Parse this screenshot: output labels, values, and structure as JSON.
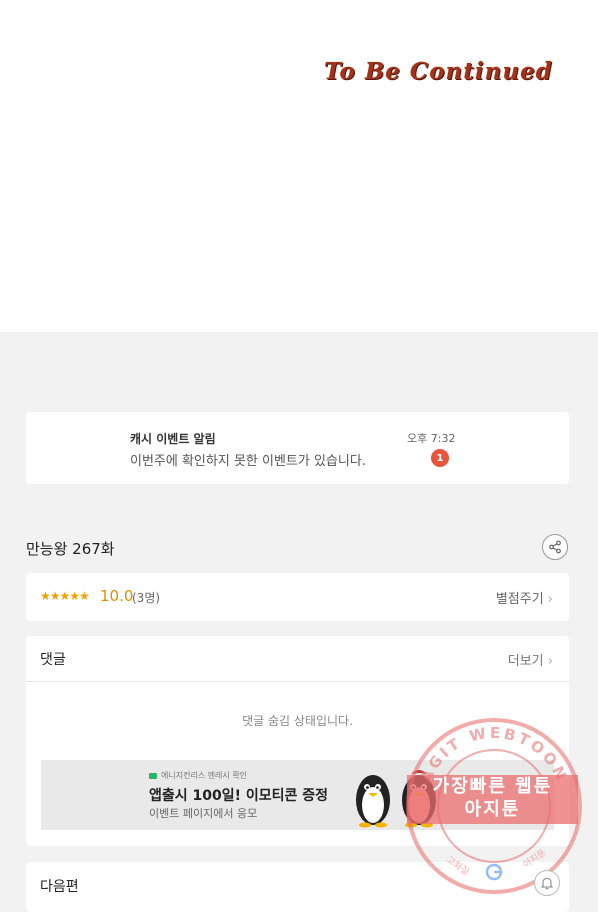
{
  "viewer": {
    "end_banner": "To Be Continued"
  },
  "notice": {
    "title": "캐시 이벤트 알림",
    "message": "이번주에 확인하지 못한 이벤트가 있습니다.",
    "time": "오후 7:32",
    "badge_count": "1"
  },
  "episode": {
    "title": "만능왕 267화",
    "share_icon": "share-icon"
  },
  "rating": {
    "stars": "★★★★★",
    "score": "10.0",
    "count": "(3명)",
    "rate_link": "별점주기"
  },
  "comments": {
    "title": "댓글",
    "more": "더보기",
    "hidden_notice": "댓글 숨김 상태입니다."
  },
  "ad": {
    "brand": "에니지컨리스 멘레시 확인",
    "title": "앱출시 100일! 이모티콘 증정",
    "subtitle": "이벤트 페이지에서 응모"
  },
  "next": {
    "title": "다음편"
  },
  "watermark": {
    "ring_text": "AGIT WEBTOON",
    "line1": "가장빠른 웹툰",
    "line2": "아지툰",
    "bottom_left": "고화질",
    "bottom_right": "아지툰"
  },
  "colors": {
    "badge": "#e8553a",
    "rating": "#f0a000",
    "watermark": "#e86a6a"
  }
}
